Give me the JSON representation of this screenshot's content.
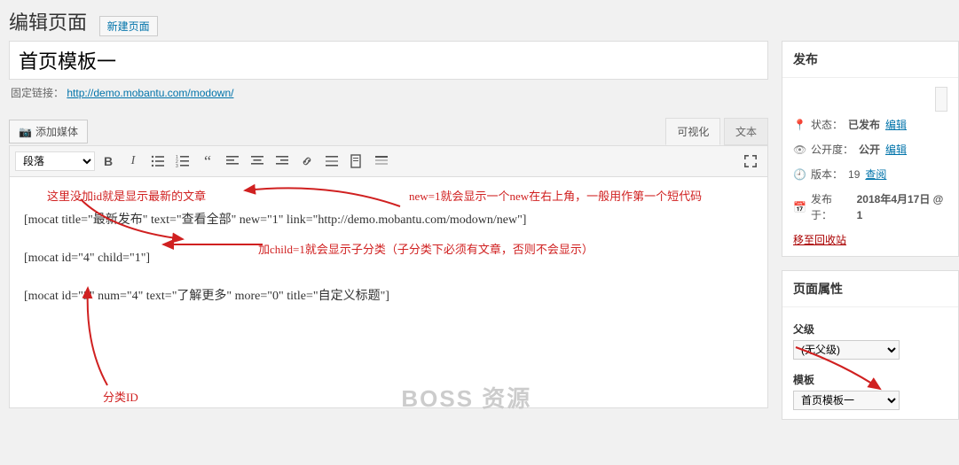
{
  "header": {
    "heading": "编辑页面",
    "new_button": "新建页面"
  },
  "title_value": "首页模板一",
  "permalink": {
    "label": "固定链接：",
    "url": "http://demo.mobantu.com/modown/"
  },
  "media_button": "添加媒体",
  "editor_tabs": {
    "visual": "可视化",
    "text": "文本"
  },
  "format_select": "段落",
  "content": {
    "line1": "[mocat title=\"最新发布\" text=\"查看全部\" new=\"1\" link=\"http://demo.mobantu.com/modown/new\"]",
    "line2": "[mocat id=\"4\" child=\"1\"]",
    "line3": "[mocat id=\"3\" num=\"4\" text=\"了解更多\" more=\"0\" title=\"自定义标题\"]"
  },
  "annotations": {
    "a1": "这里没加id就是显示最新的文章",
    "a2": "new=1就会显示一个new在右上角，一般用作第一个短代码",
    "a3": "加child=1就会显示子分类（子分类下必须有文章，否则不会显示）",
    "a4": "分类ID"
  },
  "watermark": "BOSS 资源",
  "publish": {
    "panel_title": "发布",
    "status_label": "状态：",
    "status_value": "已发布",
    "status_edit": "编辑",
    "visibility_label": "公开度：",
    "visibility_value": "公开",
    "visibility_edit": "编辑",
    "rev_label": "版本：",
    "rev_value": "19",
    "rev_link": "查阅",
    "pub_label": "发布于：",
    "pub_value": "2018年4月17日 @ 1",
    "trash": "移至回收站"
  },
  "attributes": {
    "panel_title": "页面属性",
    "parent_label": "父级",
    "parent_value": "(无父级)",
    "template_label": "模板",
    "template_value": "首页模板一"
  }
}
